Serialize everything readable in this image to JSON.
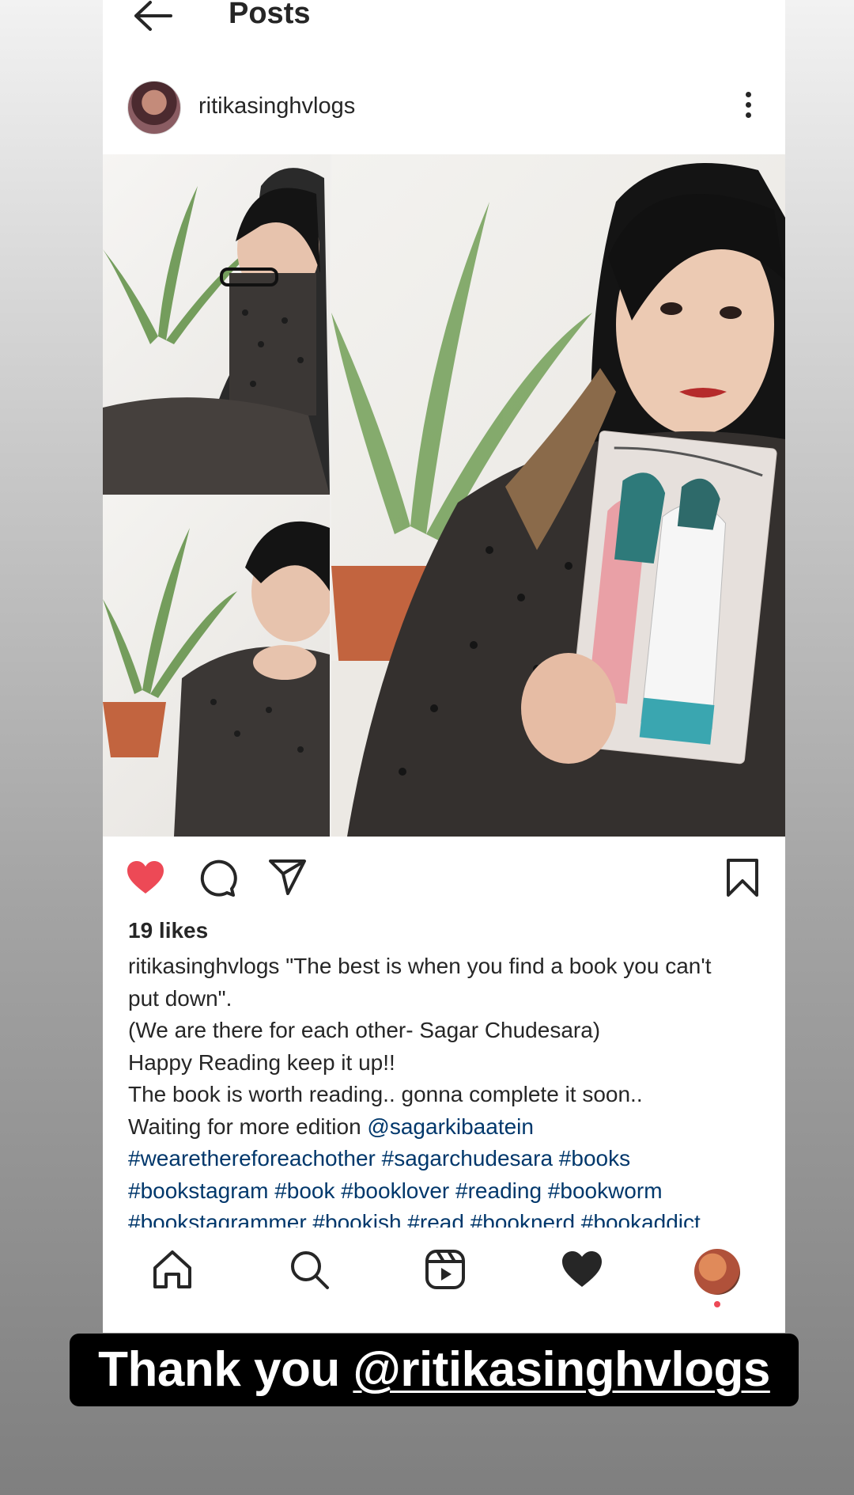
{
  "header": {
    "title": "Posts"
  },
  "post": {
    "username": "ritikasinghvlogs",
    "likes": "19 likes",
    "caption": {
      "username": "ritikasinghvlogs",
      "line1_rest": " \"The best is when you find a book you can't",
      "line2": "put down\".",
      "line3": "(We are there for each other- Sagar Chudesara)",
      "line4": "Happy Reading keep it up!!",
      "line5": "The book is worth reading.. gonna complete it soon..",
      "line6_text": "Waiting for more edition ",
      "line6_mention": "@sagarkibaatein",
      "line7_tags": "#wearethereforeachother #sagarchudesara #books",
      "line8_tags": "#bookstagram #book #booklover #reading #bookworm",
      "line9_tags": "#bookstagrammer #bookish #read #booknerd #bookaddict"
    },
    "liked": true,
    "like_color": "#ed4956",
    "link_color": "#00376b"
  },
  "icons": {
    "back": "arrow-left-icon",
    "more": "more-vertical-icon",
    "like": "heart-filled-icon",
    "comment": "comment-icon",
    "share": "send-icon",
    "save": "bookmark-icon",
    "home": "home-icon",
    "search": "search-icon",
    "reels": "reels-icon",
    "activity": "heart-filled-icon"
  },
  "overlay": {
    "text": "Thank you ",
    "mention": "@ritikasinghvlogs"
  }
}
